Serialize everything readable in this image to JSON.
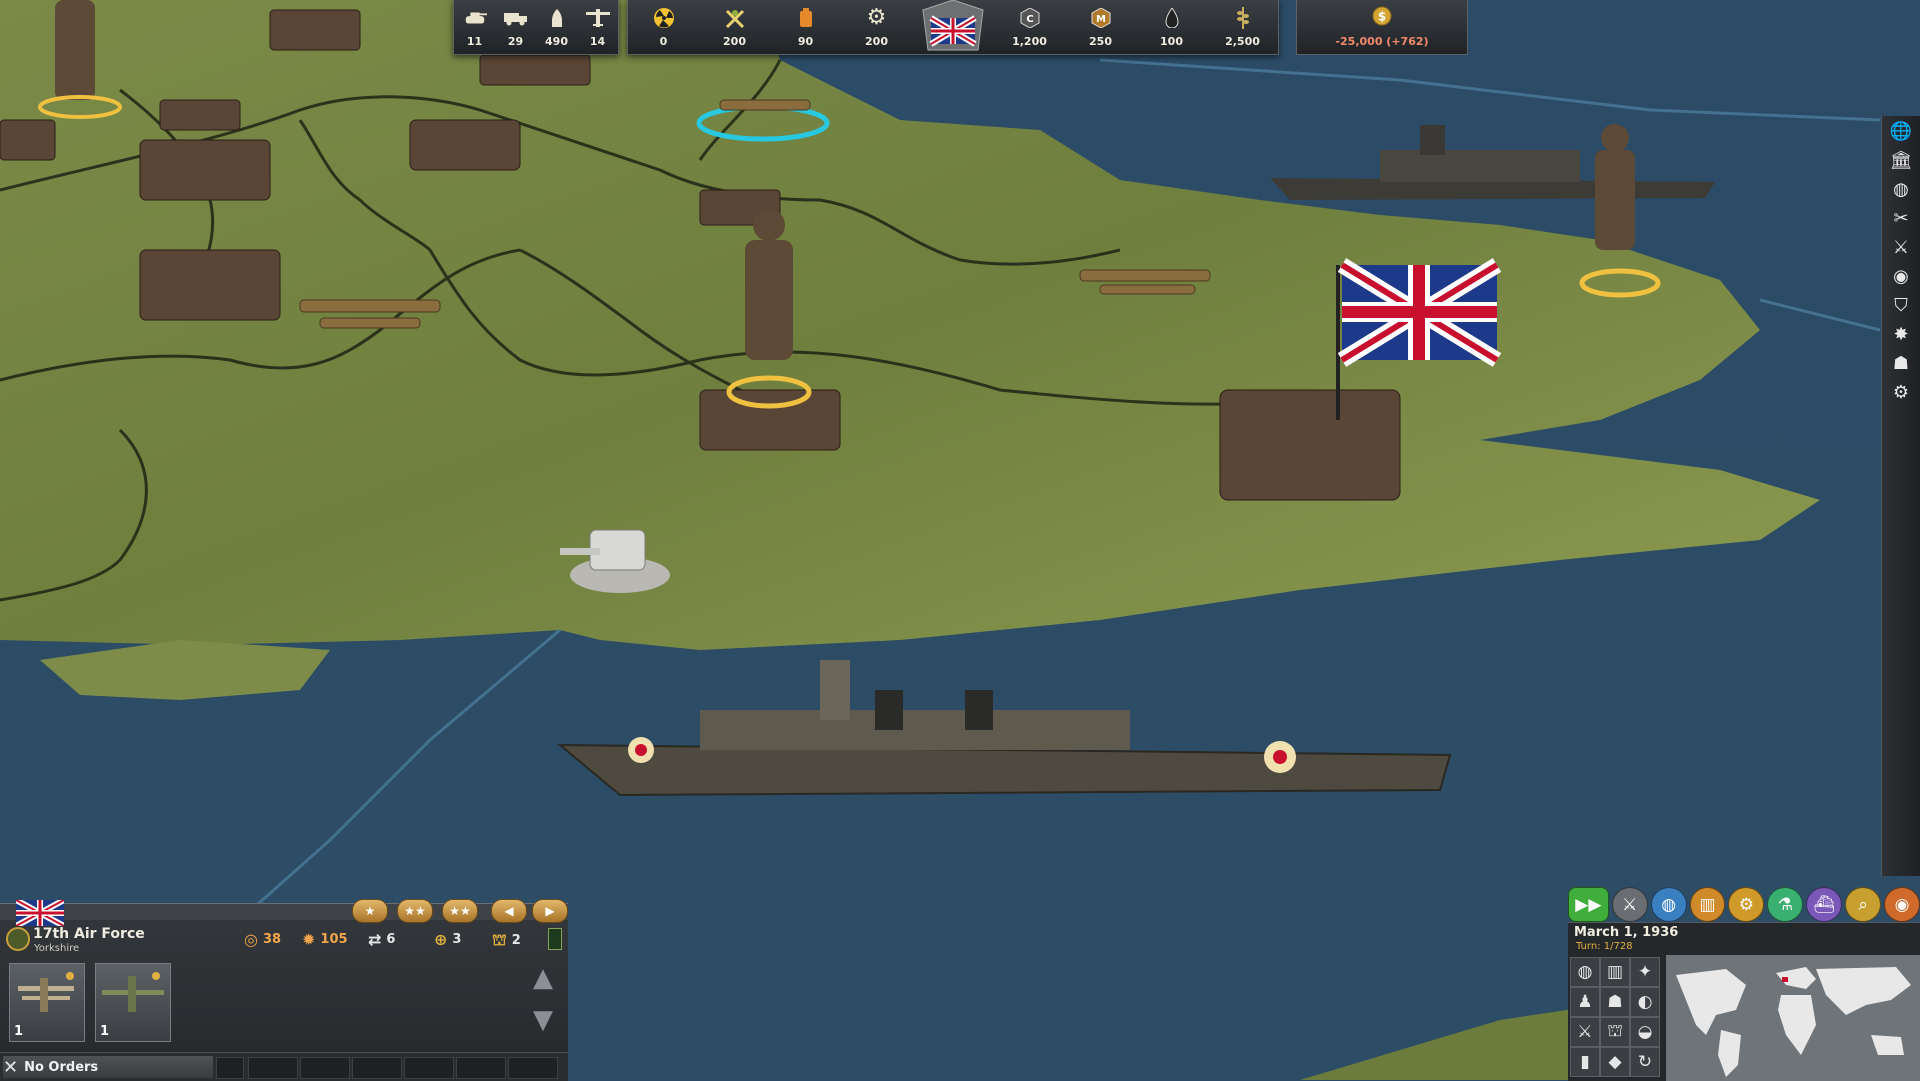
{
  "top_bar": {
    "units": [
      {
        "icon": "tank-icon",
        "value": "11"
      },
      {
        "icon": "truck-icon",
        "value": "29"
      },
      {
        "icon": "shell-icon",
        "value": "490"
      },
      {
        "icon": "plane-icon",
        "value": "14"
      }
    ],
    "resources_left": [
      {
        "icon": "nuclear-icon",
        "value": "0"
      },
      {
        "icon": "manpower-icon",
        "value": "200"
      },
      {
        "icon": "fuel-icon",
        "value": "90"
      },
      {
        "icon": "industry-gear-icon",
        "value": "200"
      }
    ],
    "resources_right": [
      {
        "icon": "coal-icon",
        "value": "1,200"
      },
      {
        "icon": "metal-icon",
        "value": "250"
      },
      {
        "icon": "oil-icon",
        "value": "100"
      },
      {
        "icon": "food-icon",
        "value": "2,500"
      }
    ],
    "money": {
      "icon": "dollar-icon",
      "value": "-25,000 (+762)"
    }
  },
  "unit_panel": {
    "name": "17th Air Force",
    "location": "Yorkshire",
    "stats": [
      {
        "icon": "target-icon",
        "value": "38",
        "color": "#f2a54a"
      },
      {
        "icon": "burst-icon",
        "value": "105",
        "color": "#f2a54a"
      },
      {
        "icon": "speed-icon",
        "value": "6",
        "color": "#e8e8e8"
      },
      {
        "icon": "supply-icon",
        "value": "3",
        "color": "#e8e8e8"
      },
      {
        "icon": "cargo-icon",
        "value": "2",
        "color": "#e8e8e8"
      }
    ],
    "cards": [
      {
        "count": "1"
      },
      {
        "count": "1"
      }
    ],
    "orders_label": "No Orders"
  },
  "bottom_right": {
    "date": "March 1, 1936",
    "turn": "Turn: 1/728"
  },
  "colors": {
    "sea": "#2b4a66",
    "land": "#6e7f3c",
    "money_negative": "#f28a6a",
    "play": "#3fae3a"
  }
}
